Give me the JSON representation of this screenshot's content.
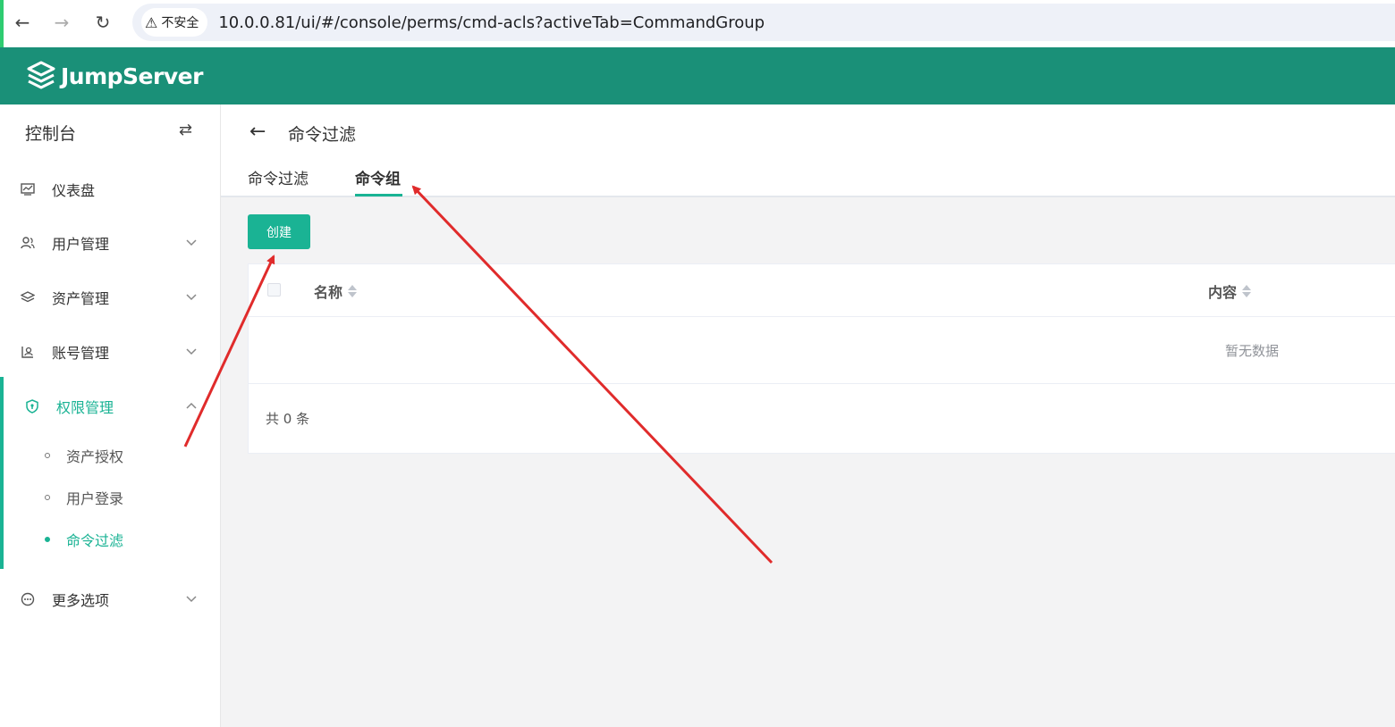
{
  "browser": {
    "security_label": "不安全",
    "url": "10.0.0.81/ui/#/console/perms/cmd-acls?activeTab=CommandGroup"
  },
  "app": {
    "logo_text": "JumpServer",
    "brand_color": "#1a9078",
    "accent_color": "#1ab394"
  },
  "sidebar": {
    "title": "控制台",
    "items": [
      {
        "label": "仪表盘",
        "icon": "dashboard-icon"
      },
      {
        "label": "用户管理",
        "icon": "users-icon"
      },
      {
        "label": "资产管理",
        "icon": "layers-icon"
      },
      {
        "label": "账号管理",
        "icon": "account-icon"
      },
      {
        "label": "权限管理",
        "icon": "shield-icon"
      },
      {
        "label": "更多选项",
        "icon": "more-icon"
      }
    ],
    "sub_items": [
      {
        "label": "资产授权"
      },
      {
        "label": "用户登录"
      },
      {
        "label": "命令过滤"
      }
    ]
  },
  "page": {
    "title": "命令过滤",
    "tabs": [
      {
        "label": "命令过滤"
      },
      {
        "label": "命令组"
      }
    ],
    "create_label": "创建"
  },
  "table": {
    "columns": [
      {
        "label": "名称"
      },
      {
        "label": "内容"
      }
    ],
    "empty_text": "暂无数据",
    "total_text": "共 0 条"
  }
}
